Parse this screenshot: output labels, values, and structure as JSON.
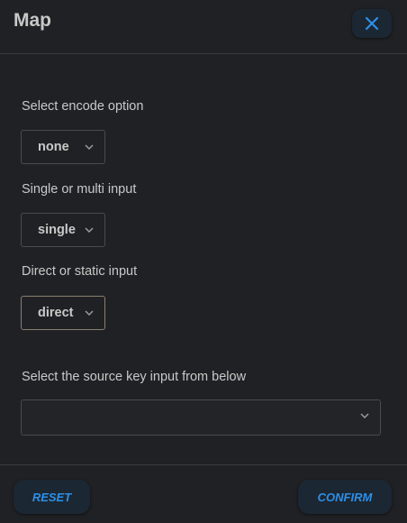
{
  "header": {
    "title": "Map",
    "close_icon": "close-icon"
  },
  "fields": {
    "encode": {
      "label": "Select encode option",
      "value": "none"
    },
    "input_mode": {
      "label": "Single or multi input",
      "value": "single"
    },
    "input_type": {
      "label": "Direct or static input",
      "value": "direct"
    },
    "source_key": {
      "label": "Select the source key input from below",
      "value": ""
    }
  },
  "footer": {
    "reset_label": "RESET",
    "confirm_label": "CONFIRM"
  },
  "colors": {
    "accent": "#2e8fe6",
    "background": "#202124",
    "button_bg": "#1b2733"
  }
}
